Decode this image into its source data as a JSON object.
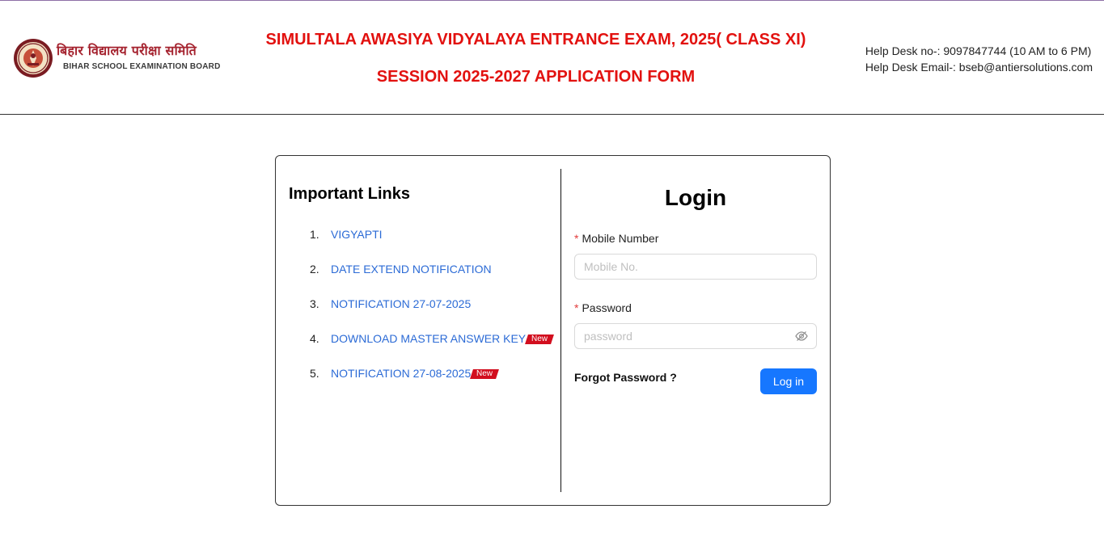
{
  "header": {
    "logo": {
      "hindi_text": "बिहार विद्यालय परीक्षा समिति",
      "english_text": "BIHAR SCHOOL EXAMINATION BOARD"
    },
    "title_line1": "SIMULTALA AWASIYA VIDYALAYA ENTRANCE EXAM, 2025( CLASS XI)",
    "title_line2": "SESSION 2025-2027 APPLICATION FORM",
    "helpdesk_phone": "Help Desk no-: 9097847744 (10 AM to 6 PM)",
    "helpdesk_email": "Help Desk Email-: bseb@antiersolutions.com"
  },
  "links": {
    "heading": "Important Links",
    "items": [
      {
        "num": "1.",
        "label": "VIGYAPTI",
        "is_new": false
      },
      {
        "num": "2.",
        "label": "DATE EXTEND NOTIFICATION",
        "is_new": false
      },
      {
        "num": "3.",
        "label": "NOTIFICATION 27-07-2025",
        "is_new": false
      },
      {
        "num": "4.",
        "label": "DOWNLOAD MASTER ANSWER KEY",
        "is_new": true
      },
      {
        "num": "5.",
        "label": "NOTIFICATION 27-08-2025",
        "is_new": true
      }
    ],
    "new_badge": "New"
  },
  "login": {
    "title": "Login",
    "required_mark": "*",
    "mobile_label": "Mobile Number",
    "mobile_value": "",
    "mobile_placeholder": "Mobile No.",
    "password_label": "Password",
    "password_value": "",
    "password_placeholder": "password",
    "forgot_label": "Forgot Password ?",
    "submit_label": "Log in",
    "accent_color": "#1677ff"
  },
  "colors": {
    "title_red": "#e2110f",
    "link_blue": "#2c6bd6",
    "badge_red": "#d20e1e",
    "logo_maroon": "#a5232f"
  },
  "icons": {
    "seal": "bseb-seal-icon",
    "password_toggle": "eye-invisible-icon"
  }
}
